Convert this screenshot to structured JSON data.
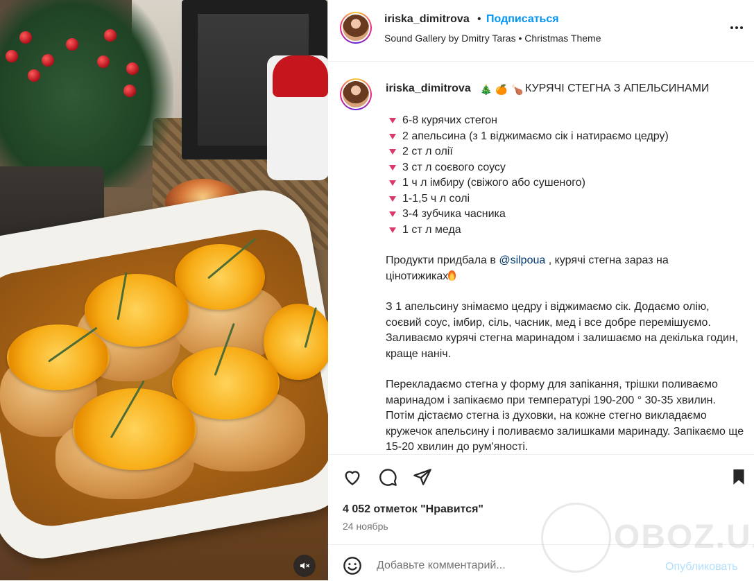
{
  "post": {
    "username": "iriska_dimitrova",
    "dot": "•",
    "follow_label": "Подписаться",
    "audio": "Sound Gallery by Dmitry Taras • Christmas Theme",
    "more_icon": "more-horizontal-icon",
    "mute_icon": "speaker-muted-icon"
  },
  "caption": {
    "username": "iriska_dimitrova",
    "emojis": [
      "🎄",
      "🍊",
      "🍗"
    ],
    "title": "КУРЯЧІ СТЕГНА З АПЕЛЬСИНАМИ",
    "ingredients": [
      "6-8 курячих стегон",
      "2 апельсина (з 1 віджимаємо сік і натираємо цедру)",
      "2 ст л олії",
      "3 ст л соєвого соусу",
      "1 ч л імбиру (свіжого або сушеного)",
      "1-1,5 ч л солі",
      "3-4 зубчика часника",
      "1 ст л меда"
    ],
    "para1_before": "Продукти придбала в ",
    "para1_mention": "@silpoua",
    "para1_after": " , курячі стегна зараз на цінотижиках",
    "para2": "З 1 апельсину знімаємо цедру і віджимаємо сік. Додаємо олію, соєвий соус, імбир, сіль, часник, мед і все добре перемішуємо. Заливаємо курячі стегна маринадом і залишаємо на декілька годин, краще наніч.",
    "para3": "Перекладаємо стегна у форму для запікання, трішки поливаємо маринадом і запікаємо при температурі 190-200 ° 30-35 хвилин. Потім дістаємо стегна із духовки, на кожне стегно викладаємо кружечок апельсину і поливаємо залишками маринаду. Запікаємо ще 15-20 хвилин до рум'яності."
  },
  "actions": {
    "icons": [
      "heart-icon",
      "comment-icon",
      "share-icon",
      "bookmark-icon"
    ],
    "likes": "4 052 отметок \"Нравится\"",
    "date": "24 ноябрь"
  },
  "comment": {
    "placeholder": "Добавьте комментарий...",
    "publish_label": "Опубликовать",
    "emoji_icon": "smiley-icon"
  },
  "watermark": {
    "text": "OBOZ.UA"
  }
}
